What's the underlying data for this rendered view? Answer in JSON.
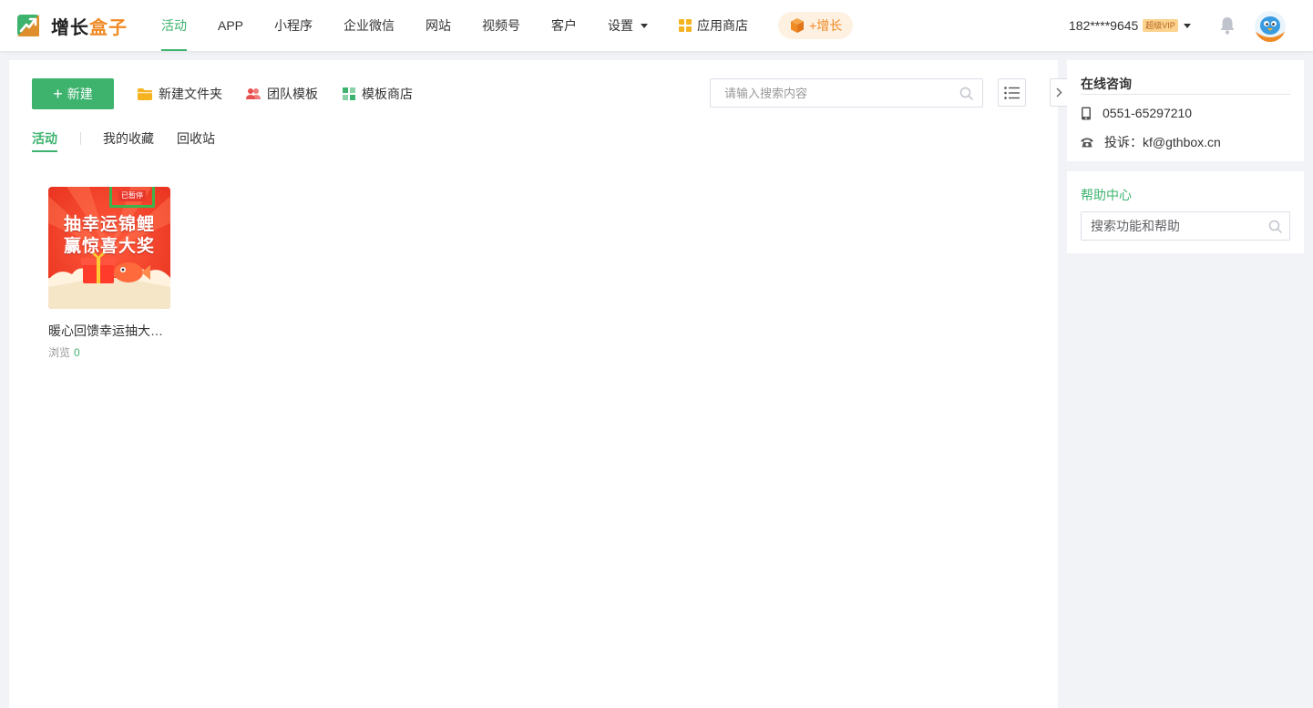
{
  "header": {
    "logo_text_main": "增长",
    "logo_text_accent": "盒子",
    "nav": [
      {
        "label": "活动"
      },
      {
        "label": "APP"
      },
      {
        "label": "小程序"
      },
      {
        "label": "企业微信"
      },
      {
        "label": "网站"
      },
      {
        "label": "视频号"
      },
      {
        "label": "客户"
      },
      {
        "label": "设置"
      },
      {
        "label": "应用商店"
      }
    ],
    "grow_label": "+增长",
    "user_phone": "182****9645",
    "vip_badge": "超级VIP",
    "icons": [
      "logo-icon",
      "chevron-down-icon",
      "app-store-grid-icon",
      "gift-box-icon",
      "bell-icon",
      "avatar"
    ]
  },
  "toolbar": {
    "new_label": "新建",
    "new_folder_label": "新建文件夹",
    "team_template_label": "团队模板",
    "template_store_label": "模板商店",
    "search_placeholder": "请输入搜索内容"
  },
  "tabs": [
    {
      "label": "活动",
      "active": true
    },
    {
      "label": "我的收藏"
    },
    {
      "label": "回收站"
    }
  ],
  "cards": [
    {
      "thumb_line1": "抽幸运锦鲤",
      "thumb_line2": "赢惊喜大奖",
      "status": "已暂停",
      "name": "暖心回馈幸运抽大奖活动",
      "views_label": "浏览",
      "views": "0"
    }
  ],
  "side": {
    "consult_title": "在线咨询",
    "phone": "0551-65297210",
    "complaint": "投诉：kf@gthbox.cn",
    "help_title": "帮助中心",
    "help_placeholder": "搜索功能和帮助"
  },
  "colors": {
    "primary_green": "#3db36e",
    "accent_orange": "#f08a24",
    "page_bg": "#f2f3f7"
  }
}
